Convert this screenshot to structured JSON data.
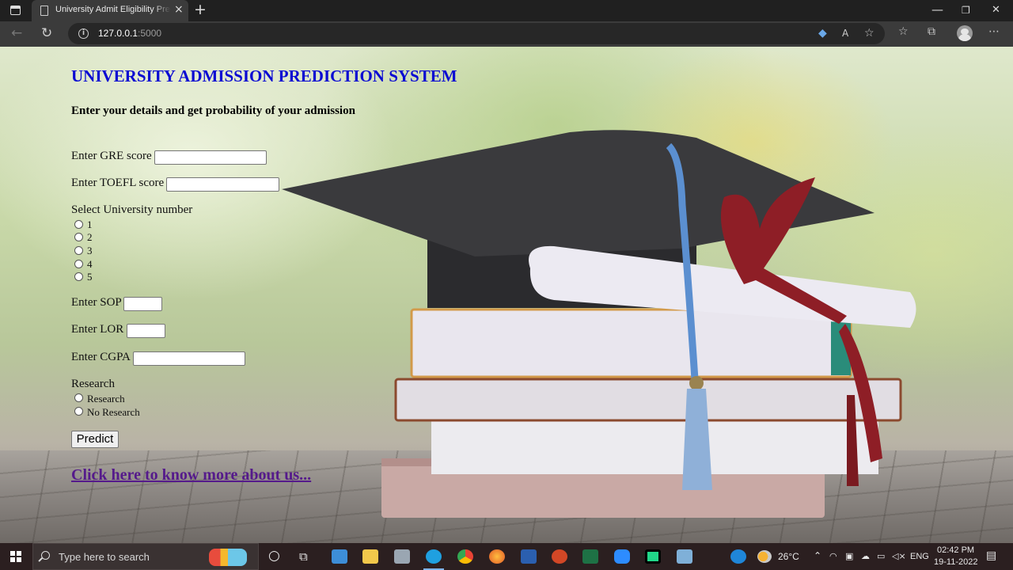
{
  "browser": {
    "tab_title": "University Admit Eligibility Predic",
    "tab_close": "×",
    "new_tab": "+",
    "url_host": "127.0.0.1",
    "url_port": ":5000",
    "window_min": "—",
    "window_max": "❐",
    "window_close": "✕"
  },
  "page": {
    "title": "UNIVERSITY ADMISSION PREDICTION SYSTEM",
    "subtitle": "Enter your details and get probability of your admission",
    "gre_label": "Enter GRE score",
    "toefl_label": "Enter TOEFL score",
    "university_label": "Select University number",
    "university_options": [
      "1",
      "2",
      "3",
      "4",
      "5"
    ],
    "sop_label": "Enter SOP",
    "lor_label": "Enter LOR",
    "cgpa_label": "Enter CGPA",
    "research_label": "Research",
    "research_options": [
      "Research",
      "No Research"
    ],
    "predict_label": "Predict",
    "about_link": "Click here to know more about us..."
  },
  "taskbar": {
    "search_placeholder": "Type here to search",
    "weather": "26°C",
    "language": "ENG",
    "time": "02:42 PM",
    "date": "19-11-2022"
  },
  "colors": {
    "title": "#0a0ad2",
    "link": "#551a8b"
  }
}
